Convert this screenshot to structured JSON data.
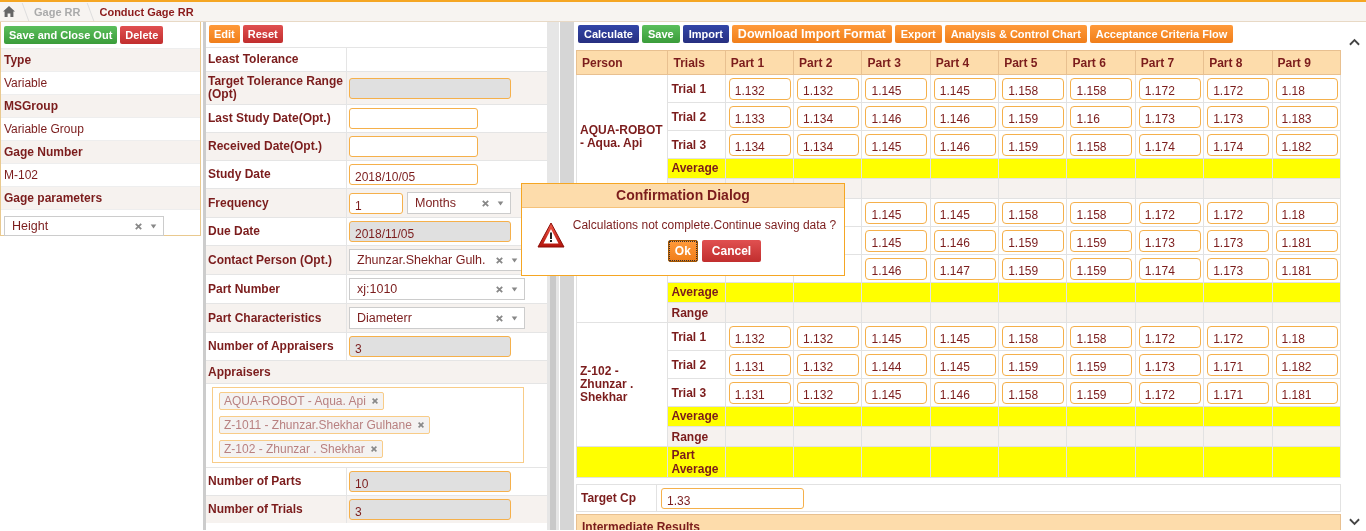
{
  "breadcrumb": [
    {
      "label": "Gage RR",
      "current": false
    },
    {
      "label": "Conduct Gage RR",
      "current": true
    }
  ],
  "left_panel": {
    "buttons": [
      {
        "label": "Save and Close Out",
        "kind": "success"
      },
      {
        "label": "Delete",
        "kind": "danger"
      }
    ],
    "fields": [
      {
        "label": "Type",
        "kind": "text",
        "value": "Variable"
      },
      {
        "label": "MSGroup",
        "kind": "text",
        "value": "Variable Group"
      },
      {
        "label": "Gage Number",
        "kind": "text",
        "value": "M-102"
      },
      {
        "label": "Gage parameters",
        "kind": "select",
        "value": "Height"
      }
    ]
  },
  "details_panel": {
    "buttons": [
      {
        "label": "Edit",
        "kind": "warning"
      },
      {
        "label": "Reset",
        "kind": "danger"
      }
    ],
    "fields": [
      {
        "label": "Least Tolerance",
        "kind": "none"
      },
      {
        "label": "Target Tolerance Range (Opt)",
        "kind": "input",
        "disabled": true
      },
      {
        "label": "Last Study Date(Opt.)",
        "kind": "input",
        "disabled": false
      },
      {
        "label": "Received Date(Opt.)",
        "kind": "input",
        "disabled": false
      },
      {
        "label": "Study Date",
        "kind": "input",
        "disabled": false,
        "value": "2018/10/05"
      },
      {
        "label": "Frequency",
        "kind": "pair",
        "disabled": false,
        "value": "1",
        "unit": "Months"
      },
      {
        "label": "Due Date",
        "kind": "input",
        "disabled": true,
        "value": "2018/11/05"
      },
      {
        "label": "Contact Person (Opt.)",
        "kind": "select",
        "value": "Zhunzar.Shekhar Gulh."
      },
      {
        "label": "Part Number",
        "kind": "select",
        "value": "xj:1010"
      },
      {
        "label": "Part Characteristics",
        "kind": "select",
        "value": "Diameterr"
      },
      {
        "label": "Number of Appraisers",
        "kind": "input",
        "disabled": true,
        "value": "3"
      },
      {
        "label": "Appraisers",
        "kind": "tags",
        "tags": [
          "AQUA-ROBOT - Aqua. Api",
          "Z-1011 - Zhunzar.Shekhar Gulhane",
          "Z-102 - Zhunzar . Shekhar"
        ]
      },
      {
        "label": "Number of Parts",
        "kind": "input",
        "disabled": true,
        "value": "10"
      },
      {
        "label": "Number of Trials",
        "kind": "input",
        "disabled": true,
        "value": "3"
      }
    ]
  },
  "toolbar": [
    {
      "label": "Calculate",
      "kind": "primary"
    },
    {
      "label": "Save",
      "kind": "success"
    },
    {
      "label": "Import",
      "kind": "primary"
    },
    {
      "label": "Download Import Format",
      "kind": "warning-large"
    },
    {
      "label": "Export",
      "kind": "warning"
    },
    {
      "label": "Analysis & Control Chart",
      "kind": "warning"
    },
    {
      "label": "Acceptance Criteria Flow",
      "kind": "warning"
    }
  ],
  "measurements": {
    "columns": [
      "Person",
      "Trials",
      "Part 1",
      "Part 2",
      "Part 3",
      "Part 4",
      "Part 5",
      "Part 6",
      "Part 7",
      "Part 8",
      "Part 9"
    ],
    "groups": [
      {
        "person": "AQUA-ROBOT - Aqua. Api",
        "rows": [
          {
            "kind": "trial",
            "label": "Trial 1",
            "values": [
              "1.132",
              "1.132",
              "1.145",
              "1.145",
              "1.158",
              "1.158",
              "1.172",
              "1.172",
              "1.18"
            ]
          },
          {
            "kind": "trial",
            "label": "Trial 2",
            "values": [
              "1.133",
              "1.134",
              "1.146",
              "1.146",
              "1.159",
              "1.16",
              "1.173",
              "1.173",
              "1.183"
            ]
          },
          {
            "kind": "trial",
            "label": "Trial 3",
            "values": [
              "1.134",
              "1.134",
              "1.145",
              "1.146",
              "1.159",
              "1.158",
              "1.174",
              "1.174",
              "1.182"
            ]
          },
          {
            "kind": "average",
            "label": "Average"
          },
          {
            "kind": "range"
          }
        ]
      },
      {
        "rows": [
          {
            "kind": "trial",
            "values": [
              "1.145",
              "1.145",
              "1.158",
              "1.158",
              "1.172",
              "1.172",
              "1.18"
            ]
          },
          {
            "kind": "trial",
            "values": [
              "1.145",
              "1.146",
              "1.159",
              "1.159",
              "1.173",
              "1.173",
              "1.181"
            ]
          },
          {
            "kind": "trial",
            "values": [
              "1.146",
              "1.147",
              "1.159",
              "1.159",
              "1.174",
              "1.173",
              "1.181"
            ]
          },
          {
            "kind": "average",
            "label": "Average"
          },
          {
            "kind": "range",
            "label": "Range"
          }
        ]
      },
      {
        "person": "Z-102 - Zhunzar . Shekhar",
        "rows": [
          {
            "kind": "trial",
            "label": "Trial 1",
            "values": [
              "1.132",
              "1.132",
              "1.145",
              "1.145",
              "1.158",
              "1.158",
              "1.172",
              "1.172",
              "1.18"
            ]
          },
          {
            "kind": "trial",
            "label": "Trial 2",
            "values": [
              "1.131",
              "1.132",
              "1.144",
              "1.145",
              "1.159",
              "1.159",
              "1.173",
              "1.171",
              "1.182"
            ]
          },
          {
            "kind": "trial",
            "label": "Trial 3",
            "values": [
              "1.131",
              "1.132",
              "1.145",
              "1.146",
              "1.158",
              "1.159",
              "1.172",
              "1.171",
              "1.181"
            ]
          },
          {
            "kind": "average",
            "label": "Average"
          },
          {
            "kind": "range",
            "label": "Range"
          }
        ]
      }
    ],
    "part_average_label": "Part Average"
  },
  "target_cp": {
    "label": "Target Cp",
    "value": "1.33"
  },
  "section_header": "Intermediate Results",
  "dialog": {
    "title": "Confirmation Dialog",
    "message": "Calculations not complete.Continue saving data ?",
    "buttons": [
      {
        "label": "Ok",
        "kind": "warning",
        "focused": true
      },
      {
        "label": "Cancel",
        "kind": "danger",
        "focused": false
      }
    ]
  }
}
